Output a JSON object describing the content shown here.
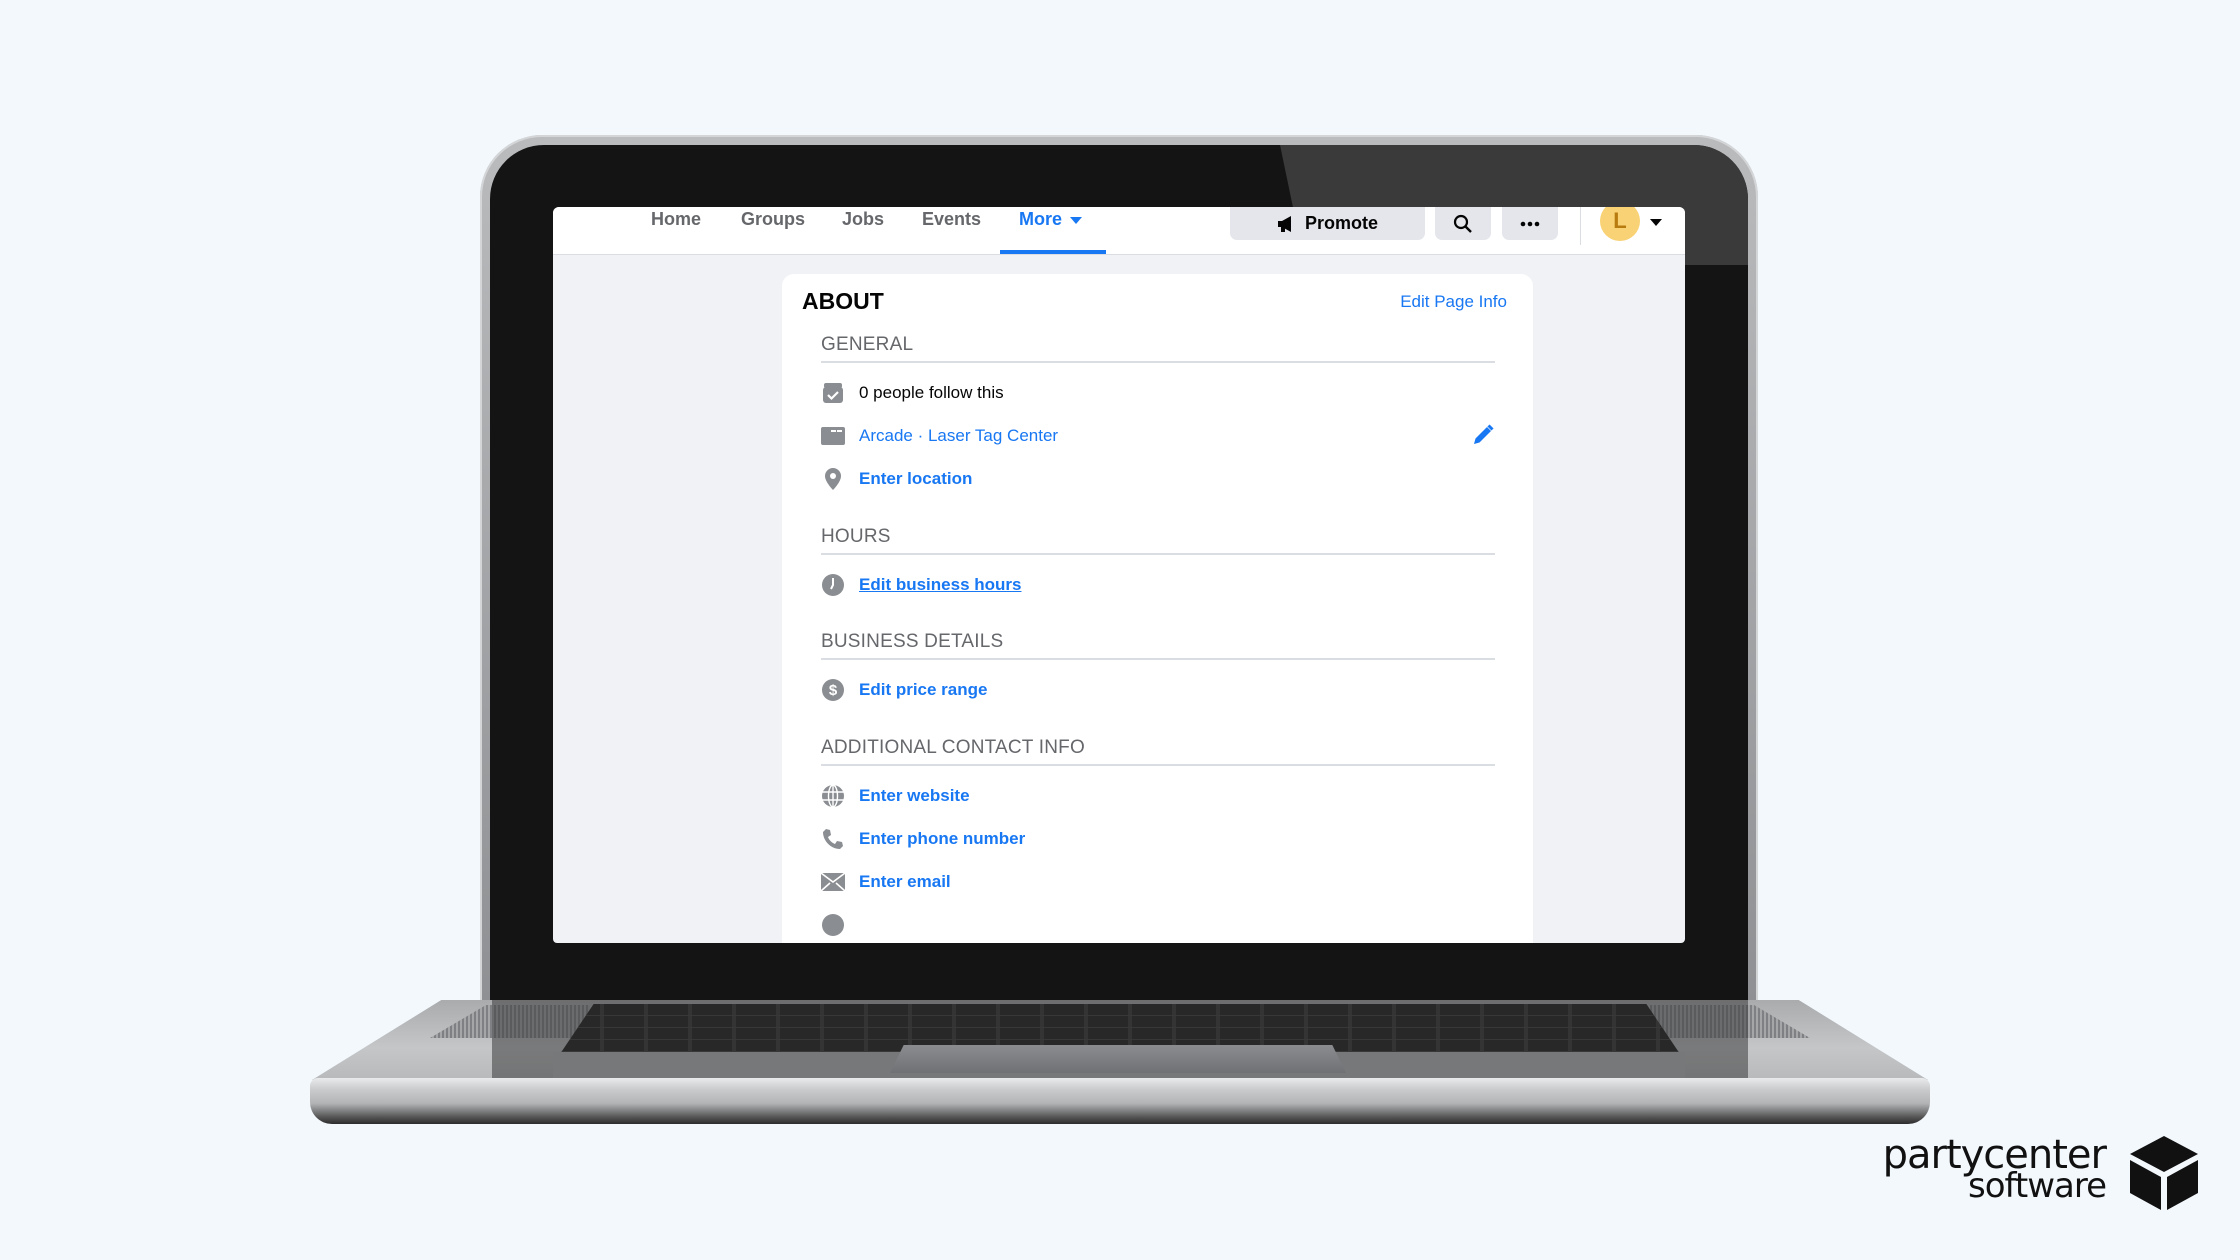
{
  "topnav": {
    "items": [
      {
        "label": "Home"
      },
      {
        "label": "Groups"
      },
      {
        "label": "Jobs"
      },
      {
        "label": "Events"
      },
      {
        "label": "More",
        "active": true
      }
    ],
    "promote_label": "Promote",
    "avatar_initial": "L",
    "accent_color": "#1877f2"
  },
  "about": {
    "title": "ABOUT",
    "edit_link": "Edit Page Info",
    "sections": {
      "general": {
        "heading": "GENERAL",
        "followers": "0 people follow this",
        "category": "Arcade · Laser Tag Center",
        "location": "Enter location"
      },
      "hours": {
        "heading": "HOURS",
        "edit": "Edit business hours"
      },
      "business": {
        "heading": "BUSINESS DETAILS",
        "price": "Edit price range"
      },
      "contact": {
        "heading": "ADDITIONAL CONTACT INFO",
        "website": "Enter website",
        "phone": "Enter phone number",
        "email": "Enter email"
      }
    }
  },
  "brand": {
    "line1": "partycenter",
    "line2": "software"
  }
}
